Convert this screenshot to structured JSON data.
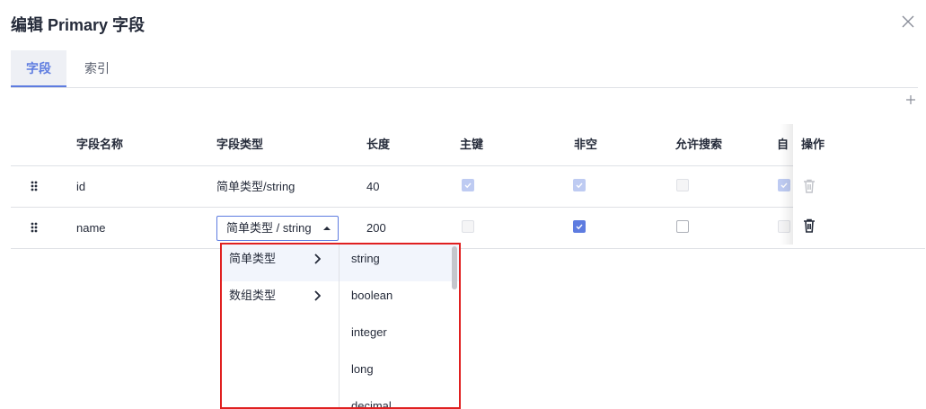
{
  "dialog": {
    "title": "编辑 Primary 字段"
  },
  "tabs": [
    {
      "label": "字段",
      "active": true
    },
    {
      "label": "索引",
      "active": false
    }
  ],
  "table": {
    "headers": {
      "name": "字段名称",
      "type": "字段类型",
      "length": "长度",
      "primary_key": "主键",
      "not_null": "非空",
      "searchable": "允许搜索",
      "auto": "自",
      "actions": "操作"
    },
    "rows": [
      {
        "name": "id",
        "type": "简单类型/string",
        "length": "40",
        "primary_key": true,
        "not_null": true,
        "searchable": false,
        "auto": true,
        "editable": false
      },
      {
        "name": "name",
        "type": "简单类型 / string",
        "length": "200",
        "primary_key": false,
        "not_null": true,
        "searchable": false,
        "auto": false,
        "editable": true
      }
    ]
  },
  "cascader": {
    "categories": [
      {
        "label": "简单类型",
        "active": true
      },
      {
        "label": "数组类型",
        "active": false
      }
    ],
    "options": [
      {
        "label": "string",
        "active": true
      },
      {
        "label": "boolean",
        "active": false
      },
      {
        "label": "integer",
        "active": false
      },
      {
        "label": "long",
        "active": false
      },
      {
        "label": "decimal",
        "active": false
      }
    ]
  },
  "colors": {
    "brand": "#5e7ce0",
    "highlight_border": "#e02020"
  },
  "icons": {
    "close": "close-icon",
    "add": "plus-icon",
    "drag": "drag-handle-icon",
    "delete": "trash-icon",
    "expand": "chevron-right-icon",
    "caret": "caret-up-icon"
  }
}
